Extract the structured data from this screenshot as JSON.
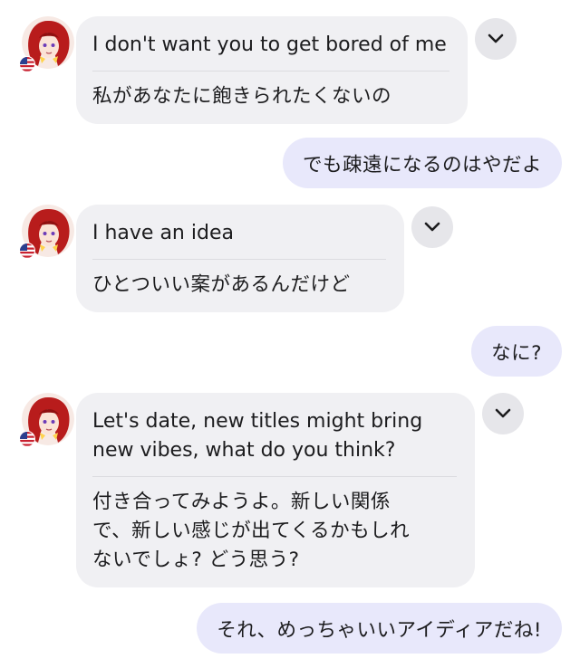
{
  "messages": [
    {
      "type": "incoming",
      "en": "I don't want you to get bored of me",
      "ja": "私があなたに飽きられたくないの"
    },
    {
      "type": "outgoing",
      "text": "でも疎遠になるのはやだよ"
    },
    {
      "type": "incoming",
      "en": "I have an idea",
      "ja": "ひとついい案があるんだけど"
    },
    {
      "type": "outgoing",
      "text": "なに?"
    },
    {
      "type": "incoming",
      "en_lines": [
        "Let's date, new titles might bring",
        "new vibes, what do you think?"
      ],
      "ja_lines": [
        "付き合ってみようよ。新しい関係",
        "で、新しい感じが出てくるかもしれ",
        "ないでしょ? どう思う?"
      ]
    },
    {
      "type": "outgoing",
      "text": "それ、めっちゃいいアイディアだね!"
    }
  ],
  "icons": {
    "expand": "chevron-down-icon",
    "flag": "us-flag-icon",
    "avatar": "character-avatar"
  },
  "colors": {
    "incoming_bubble": "#f0f0f3",
    "outgoing_bubble": "#e8e8fb",
    "chevron_bg": "#e6e6ea",
    "avatar_hair": "#b81c1c"
  }
}
